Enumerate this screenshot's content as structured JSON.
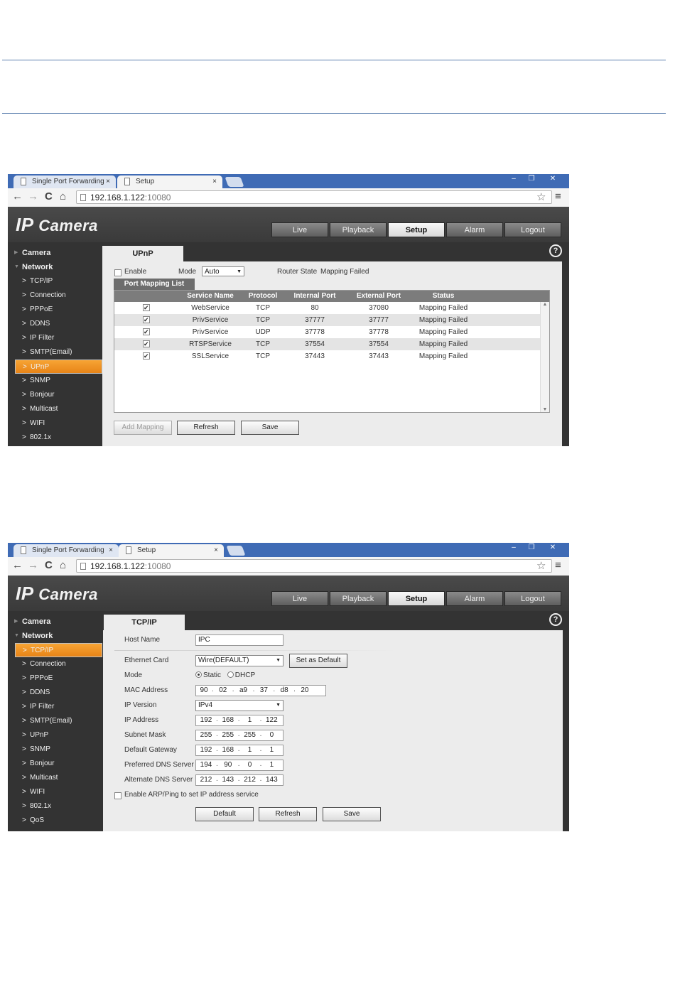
{
  "screens": [
    {
      "browser": {
        "tabs": [
          "Single Port Forwarding",
          "Setup"
        ],
        "close_glyph": "×",
        "url_host": "192.168.1.122",
        "url_port": ":10080"
      },
      "app": {
        "logo_ip": "IP",
        "logo_camera": " Camera",
        "nav": [
          "Live",
          "Playback",
          "Setup",
          "Alarm",
          "Logout"
        ],
        "nav_active": "Setup",
        "sidebar": {
          "group1": "Camera",
          "group2": "Network",
          "items": [
            "TCP/IP",
            "Connection",
            "PPPoE",
            "DDNS",
            "IP Filter",
            "SMTP(Email)",
            "UPnP",
            "SNMP",
            "Bonjour",
            "Multicast",
            "WIFI",
            "802.1x"
          ],
          "active": "UPnP"
        },
        "page_tab": "UPnP",
        "upnp": {
          "enable_label": "Enable",
          "mode_label": "Mode",
          "mode_value": "Auto",
          "router_state_label": "Router State",
          "router_state_value": "Mapping Failed",
          "list_tab": "Port Mapping List",
          "columns": [
            "Service Name",
            "Protocol",
            "Internal Port",
            "External Port",
            "Status"
          ],
          "rows": [
            {
              "name": "WebService",
              "protocol": "TCP",
              "internal": "80",
              "external": "37080",
              "status": "Mapping Failed"
            },
            {
              "name": "PrivService",
              "protocol": "TCP",
              "internal": "37777",
              "external": "37777",
              "status": "Mapping Failed"
            },
            {
              "name": "PrivService",
              "protocol": "UDP",
              "internal": "37778",
              "external": "37778",
              "status": "Mapping Failed"
            },
            {
              "name": "RTSPService",
              "protocol": "TCP",
              "internal": "37554",
              "external": "37554",
              "status": "Mapping Failed"
            },
            {
              "name": "SSLService",
              "protocol": "TCP",
              "internal": "37443",
              "external": "37443",
              "status": "Mapping Failed"
            }
          ],
          "buttons": [
            "Add Mapping",
            "Refresh",
            "Save"
          ]
        }
      }
    },
    {
      "browser": {
        "tabs": [
          "Single Port Forwarding",
          "Setup"
        ],
        "close_glyph": "×",
        "url_host": "192.168.1.122",
        "url_port": ":10080"
      },
      "app": {
        "logo_ip": "IP",
        "logo_camera": " Camera",
        "nav": [
          "Live",
          "Playback",
          "Setup",
          "Alarm",
          "Logout"
        ],
        "nav_active": "Setup",
        "sidebar": {
          "group1": "Camera",
          "group2": "Network",
          "items": [
            "TCP/IP",
            "Connection",
            "PPPoE",
            "DDNS",
            "IP Filter",
            "SMTP(Email)",
            "UPnP",
            "SNMP",
            "Bonjour",
            "Multicast",
            "WIFI",
            "802.1x",
            "QoS"
          ],
          "active": "TCP/IP"
        },
        "page_tab": "TCP/IP",
        "tcpip": {
          "host_name_label": "Host Name",
          "host_name_value": "IPC",
          "ethernet_label": "Ethernet Card",
          "ethernet_value": "Wire(DEFAULT)",
          "set_default_label": "Set as Default",
          "mode_label": "Mode",
          "mode_static": "Static",
          "mode_dhcp": "DHCP",
          "mac_label": "MAC Address",
          "mac": [
            "90",
            "02",
            "a9",
            "37",
            "d8",
            "20"
          ],
          "ipver_label": "IP Version",
          "ipver_value": "IPv4",
          "ip_label": "IP Address",
          "ip": [
            "192",
            "168",
            "1",
            "122"
          ],
          "mask_label": "Subnet Mask",
          "mask": [
            "255",
            "255",
            "255",
            "0"
          ],
          "gw_label": "Default Gateway",
          "gw": [
            "192",
            "168",
            "1",
            "1"
          ],
          "dns1_label": "Preferred DNS Server",
          "dns1": [
            "194",
            "90",
            "0",
            "1"
          ],
          "dns2_label": "Alternate DNS Server",
          "dns2": [
            "212",
            "143",
            "212",
            "143"
          ],
          "arp_label": "Enable ARP/Ping to set IP address service",
          "buttons": [
            "Default",
            "Refresh",
            "Save"
          ]
        }
      }
    }
  ],
  "colors": {
    "accent_active": "#f39a2a",
    "browser_frame": "#3f6bb5",
    "header_dark": "#3a3a3a",
    "content_bg": "#ececec"
  },
  "icons": {
    "back": "←",
    "forward": "→",
    "reload": "C",
    "home": "⌂",
    "star": "☆",
    "menu": "≡",
    "help": "?",
    "chevron": "›",
    "minimize": "–",
    "restore": "❐",
    "close": "✕"
  }
}
